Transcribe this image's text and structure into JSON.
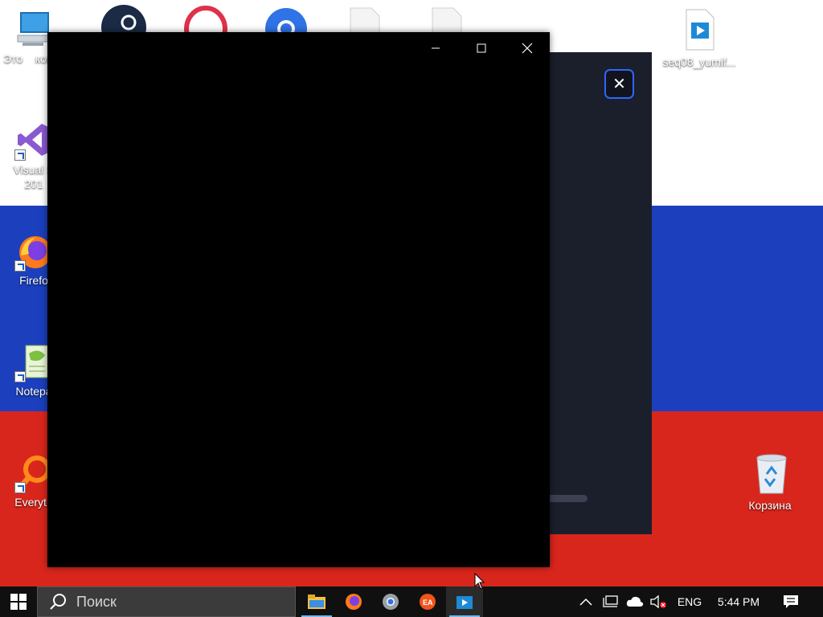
{
  "desktop": {
    "icons": [
      {
        "name": "this-pc",
        "label": "Это    компь"
      },
      {
        "name": "visual-studio",
        "label": "Visual S",
        "label2": "201"
      },
      {
        "name": "firefox",
        "label": "Firefo"
      },
      {
        "name": "notepad",
        "label": "Notepa"
      },
      {
        "name": "everything",
        "label": "Everyth"
      },
      {
        "name": "video-file",
        "label": "seq08_yumif..."
      },
      {
        "name": "recycle-bin",
        "label": "Корзина"
      }
    ]
  },
  "dark_window": {
    "close_symbol": "✕"
  },
  "black_window": {
    "minimize_symbol": "—",
    "maximize_symbol": "☐",
    "close_symbol": "✕"
  },
  "taskbar": {
    "search_placeholder": "Поиск",
    "apps": [
      "file-explorer",
      "firefox",
      "chrome",
      "ea-app",
      "media-player"
    ],
    "tray": {
      "language": "ENG",
      "time": "5:44 PM"
    }
  },
  "colors": {
    "flag_white": "#ffffff",
    "flag_blue": "#1b3fbd",
    "flag_red": "#d9261c",
    "taskbar": "#101010",
    "accent": "#2f66ff"
  }
}
